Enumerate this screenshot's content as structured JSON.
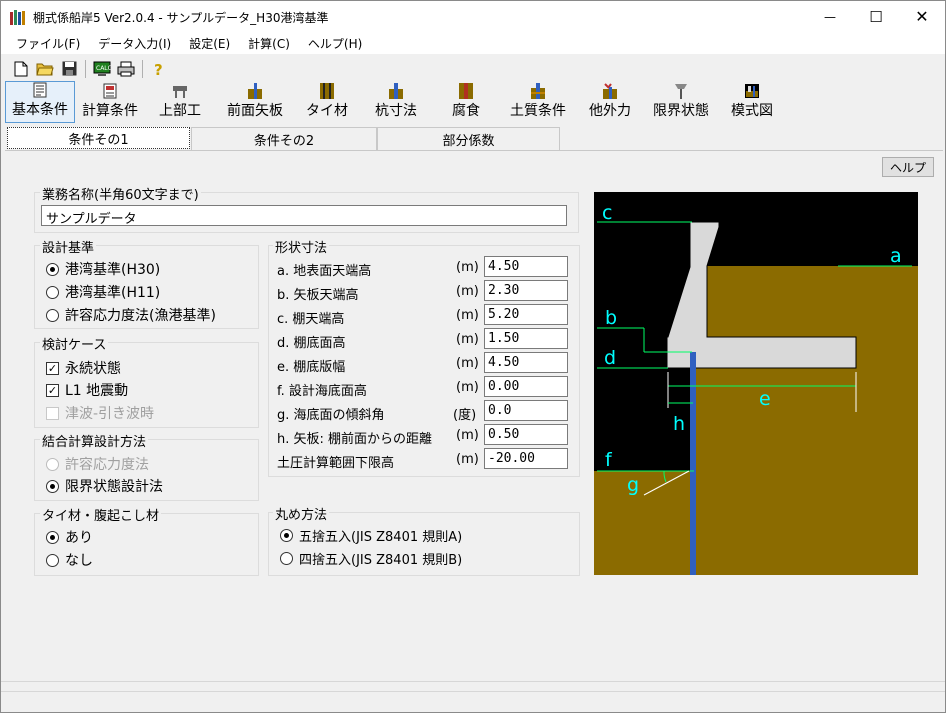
{
  "window": {
    "title": "棚式係船岸5 Ver2.0.4 - サンプルデータ_H30港湾基準",
    "minimize": "—",
    "maximize": "☐",
    "close": "✕"
  },
  "menu": [
    "ファイル(F)",
    "データ入力(I)",
    "設定(E)",
    "計算(C)",
    "ヘルプ(H)"
  ],
  "toolbar_icons": [
    "new-file-icon",
    "open-folder-icon",
    "save-icon",
    "calc-icon",
    "print-icon",
    "help-icon"
  ],
  "toolbar2": [
    {
      "label": "基本条件",
      "icon": "basic-conditions-icon"
    },
    {
      "label": "計算条件",
      "icon": "calc-conditions-icon"
    },
    {
      "label": "上部工",
      "icon": "superstructure-icon"
    },
    {
      "label": "前面矢板",
      "icon": "front-sheet-pile-icon"
    },
    {
      "label": "タイ材",
      "icon": "tie-rod-icon"
    },
    {
      "label": "杭寸法",
      "icon": "pile-dimension-icon"
    },
    {
      "label": "腐食",
      "icon": "corrosion-icon"
    },
    {
      "label": "土質条件",
      "icon": "soil-conditions-icon"
    },
    {
      "label": "他外力",
      "icon": "external-force-icon"
    },
    {
      "label": "限界状態",
      "icon": "limit-state-icon"
    },
    {
      "label": "模式図",
      "icon": "schematic-icon"
    }
  ],
  "tabs": [
    "条件その1",
    "条件その2",
    "部分係数"
  ],
  "help_button": "ヘルプ",
  "project": {
    "title": "業務名称(半角60文字まで)",
    "value": "サンプルデータ"
  },
  "standard": {
    "title": "設計基準",
    "options": [
      "港湾基準(H30)",
      "港湾基準(H11)",
      "許容応力度法(漁港基準)"
    ],
    "selected": 0
  },
  "cases": {
    "title": "検討ケース",
    "items": [
      {
        "label": "永続状態",
        "checked": true,
        "enabled": true
      },
      {
        "label": "L1 地震動",
        "checked": true,
        "enabled": true
      },
      {
        "label": "津波-引き波時",
        "checked": false,
        "enabled": false
      }
    ]
  },
  "combined": {
    "title": "結合計算設計方法",
    "options": [
      "許容応力度法",
      "限界状態設計法"
    ],
    "selected": 1
  },
  "tie": {
    "title": "タイ材・腹起こし材",
    "options": [
      "あり",
      "なし"
    ],
    "selected": 0
  },
  "dims": {
    "title": "形状寸法",
    "rows": [
      {
        "label": "a. 地表面天端高",
        "unit": "(m)",
        "value": "4.50"
      },
      {
        "label": "b. 矢板天端高",
        "unit": "(m)",
        "value": "2.30"
      },
      {
        "label": "c. 棚天端高",
        "unit": "(m)",
        "value": "5.20"
      },
      {
        "label": "d. 棚底面高",
        "unit": "(m)",
        "value": "1.50"
      },
      {
        "label": "e. 棚底版幅",
        "unit": "(m)",
        "value": "4.50"
      },
      {
        "label": "f. 設計海底面高",
        "unit": "(m)",
        "value": "0.00"
      },
      {
        "label": "g. 海底面の傾斜角",
        "unit": "(度)",
        "value": "0.0"
      },
      {
        "label": "h. 矢板: 棚前面からの距離",
        "unit": "(m)",
        "value": "0.50"
      },
      {
        "label": "土圧計算範囲下限高",
        "unit": "(m)",
        "value": "-20.00"
      }
    ]
  },
  "rounding": {
    "title": "丸め方法",
    "options": [
      "五捨五入(JIS Z8401 規則A)",
      "四捨五入(JIS Z8401 規則B)"
    ],
    "selected": 0
  },
  "diagram": {
    "labels": {
      "a": "a",
      "b": "b",
      "c": "c",
      "d": "d",
      "e": "e",
      "f": "f",
      "g": "g",
      "h": "h"
    },
    "colors": {
      "background": "#000000",
      "soil": "#8b6b00",
      "structure": "#d9d9d9",
      "pile": "#3060c0",
      "dimension": "#00ff66",
      "label": "#00ffff"
    }
  }
}
